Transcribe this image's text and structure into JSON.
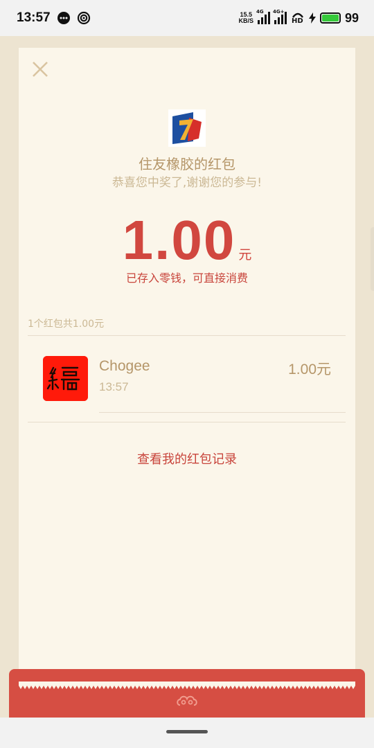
{
  "status_bar": {
    "time": "13:57",
    "net_speed_value": "15.5",
    "net_speed_unit": "KB/S",
    "sim1_label": "4G",
    "sim2_label": "4G+",
    "hd_label": "HD",
    "battery_level": "99",
    "battery_color": "#35c93a"
  },
  "red_packet": {
    "sender": "住友橡胶的红包",
    "greeting": "恭喜您中奖了,谢谢您的参与!",
    "amount": "1.00",
    "currency": "元",
    "stored_note": "已存入零钱，可直接消费",
    "summary": "1个红包共1.00元",
    "history_link": "查看我的红包记录"
  },
  "records": [
    {
      "name": "Chogee",
      "time": "13:57",
      "amount": "1.00元",
      "avatar_color": "#ff1a0a"
    }
  ],
  "colors": {
    "accent_red": "#d1473f",
    "text_gold": "#b59669",
    "text_light_gold": "#cbb894",
    "card_bg": "#fbf6ea",
    "page_bg": "#ede4d1"
  }
}
